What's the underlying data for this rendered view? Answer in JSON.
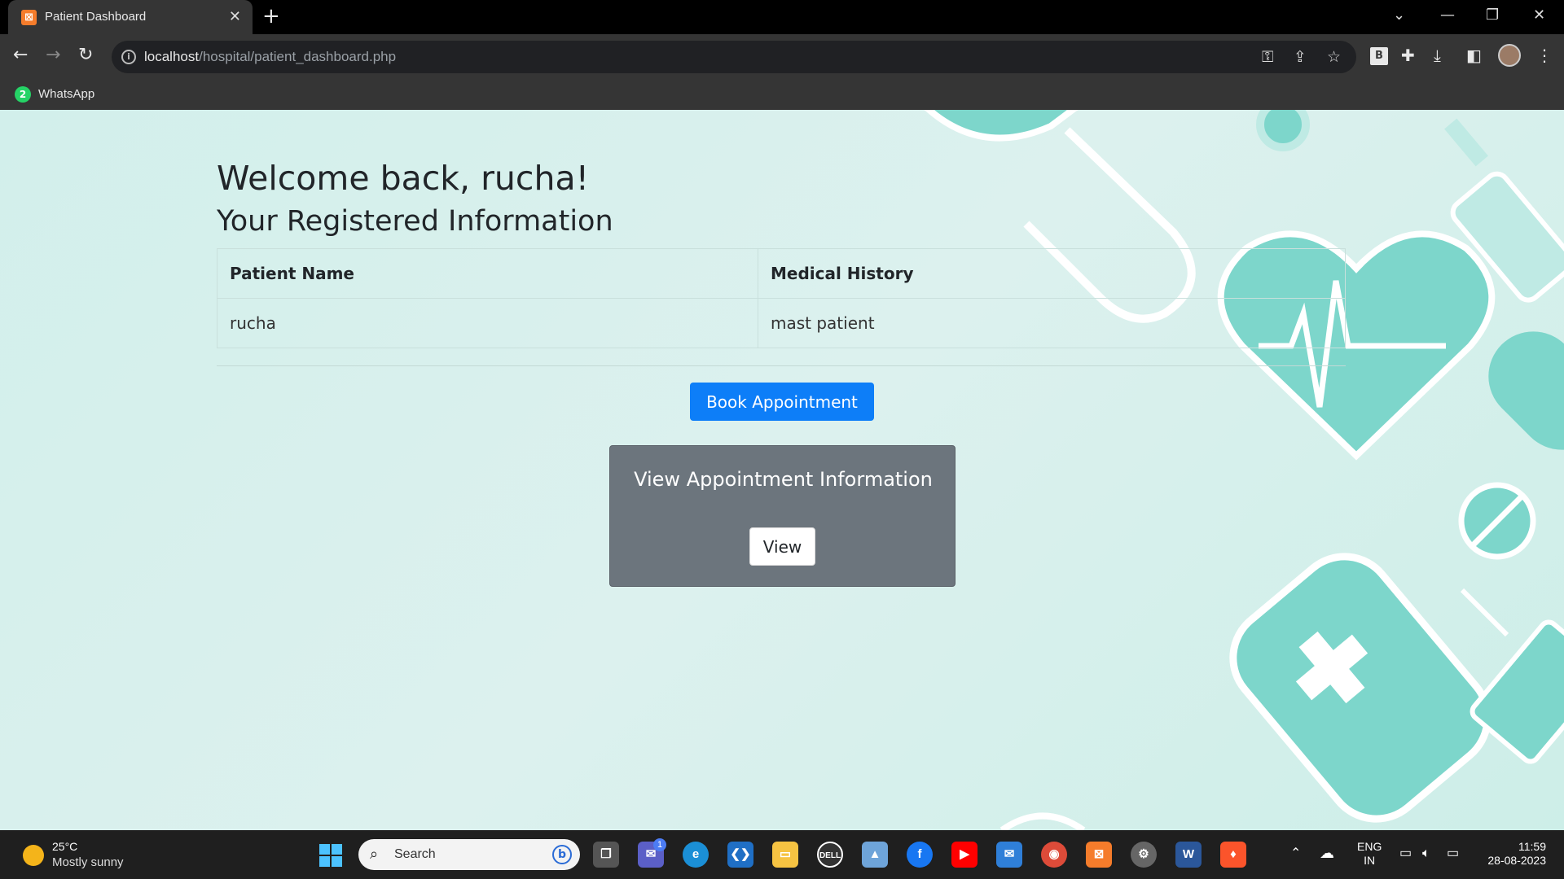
{
  "browser": {
    "tab_title": "Patient Dashboard",
    "url_host": "localhost",
    "url_path": "/hospital/patient_dashboard.php",
    "bookmark_label": "WhatsApp",
    "bookmark_badge": "2",
    "extension_badge": "B"
  },
  "page": {
    "welcome": "Welcome back, rucha!",
    "subtitle": "Your Registered Information",
    "table": {
      "headers": [
        "Patient Name",
        "Medical History"
      ],
      "rows": [
        [
          "rucha",
          "mast patient"
        ]
      ]
    },
    "book_button": "Book Appointment",
    "card_title": "View Appointment Information",
    "view_button": "View"
  },
  "taskbar": {
    "weather_temp": "25°C",
    "weather_desc": "Mostly sunny",
    "search_placeholder": "Search",
    "teams_badge": "1",
    "lang_top": "ENG",
    "lang_bottom": "IN",
    "time": "11:59",
    "date": "28-08-2023"
  },
  "colors": {
    "page_bg": "#d6f0ec",
    "accent_teal": "#7dd6cb",
    "primary_button": "#0d7ef8",
    "card_bg": "#6c757d"
  }
}
